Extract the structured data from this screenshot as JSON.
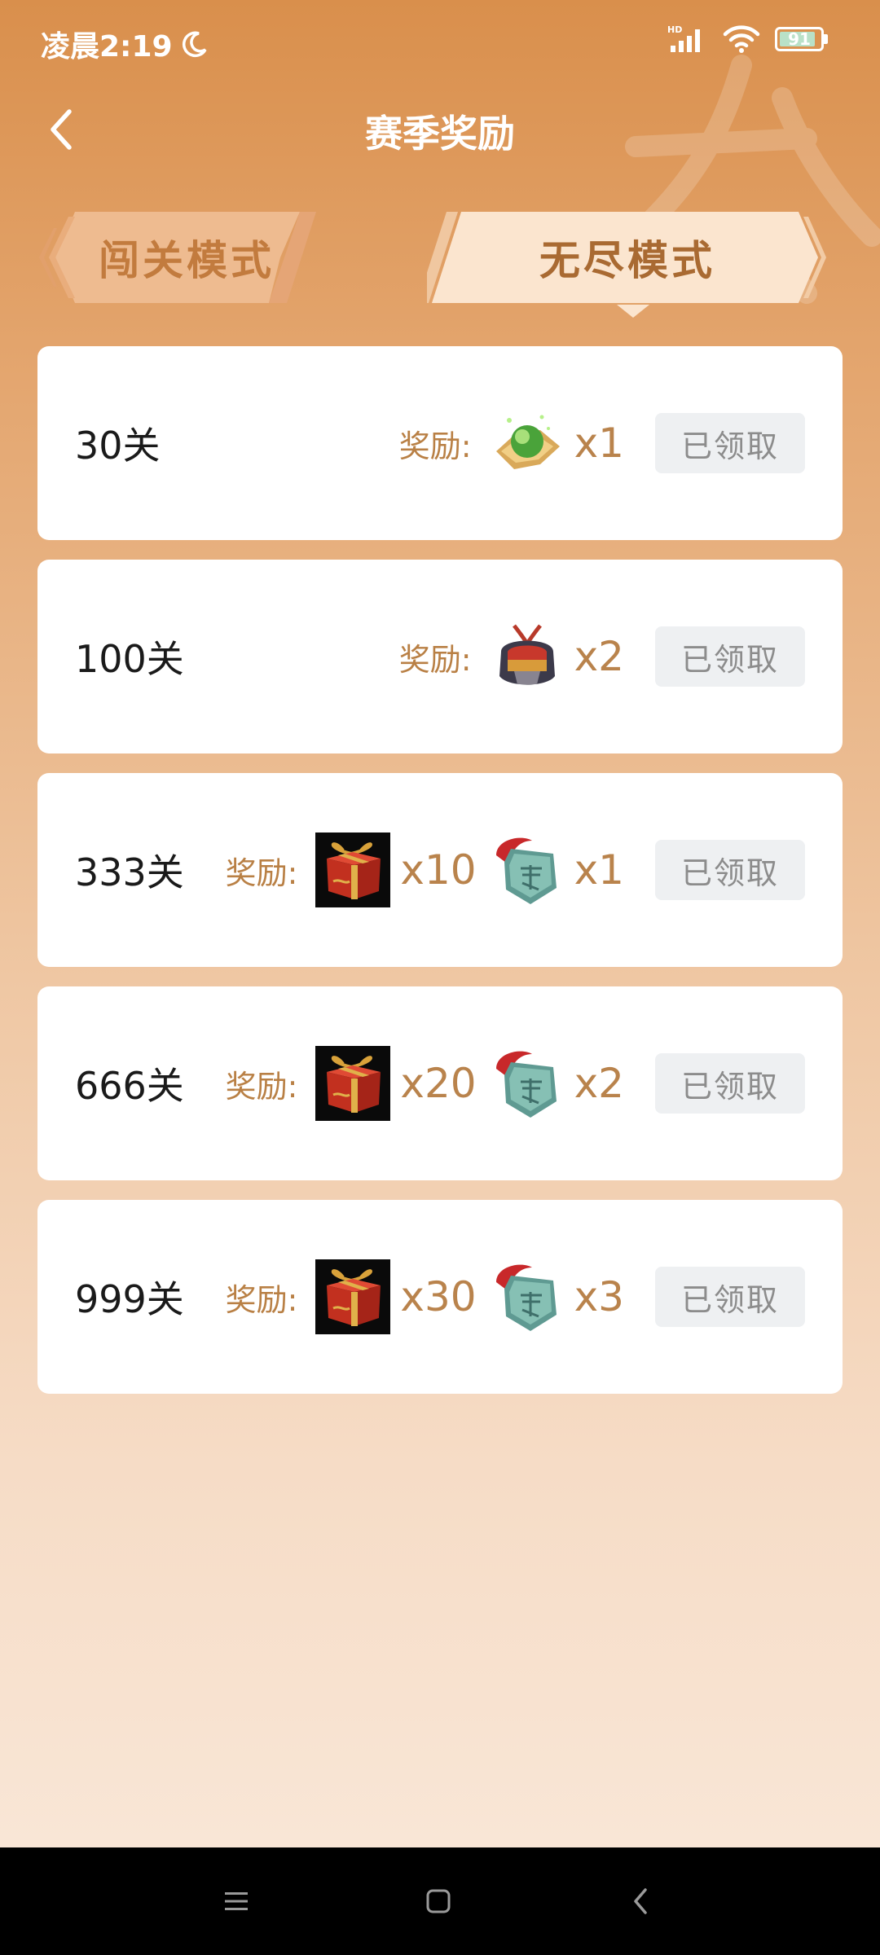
{
  "status_bar": {
    "time": "凌晨2:19",
    "network": "HD",
    "battery_level": "91"
  },
  "header": {
    "title": "赛季奖励"
  },
  "tabs": [
    {
      "label": "闯关模式",
      "active": false
    },
    {
      "label": "无尽模式",
      "active": true
    }
  ],
  "reward_label": "奖励:",
  "rows": [
    {
      "level": "30关",
      "items": [
        {
          "icon": "green-orb-icon",
          "qty": "x1"
        }
      ],
      "status": "已领取"
    },
    {
      "level": "100关",
      "items": [
        {
          "icon": "helmet-icon",
          "qty": "x2"
        }
      ],
      "status": "已领取"
    },
    {
      "level": "333关",
      "items": [
        {
          "icon": "gift-box-icon",
          "qty": "x10"
        },
        {
          "icon": "general-token-icon",
          "qty": "x1"
        }
      ],
      "status": "已领取"
    },
    {
      "level": "666关",
      "items": [
        {
          "icon": "gift-box-icon",
          "qty": "x20"
        },
        {
          "icon": "general-token-icon",
          "qty": "x2"
        }
      ],
      "status": "已领取"
    },
    {
      "level": "999关",
      "items": [
        {
          "icon": "gift-box-icon",
          "qty": "x30"
        },
        {
          "icon": "general-token-icon",
          "qty": "x3"
        }
      ],
      "status": "已领取"
    }
  ],
  "colors": {
    "accent": "#b9834c",
    "header_bg": "#d98f4c",
    "claimed_bg": "#eef0f2"
  }
}
